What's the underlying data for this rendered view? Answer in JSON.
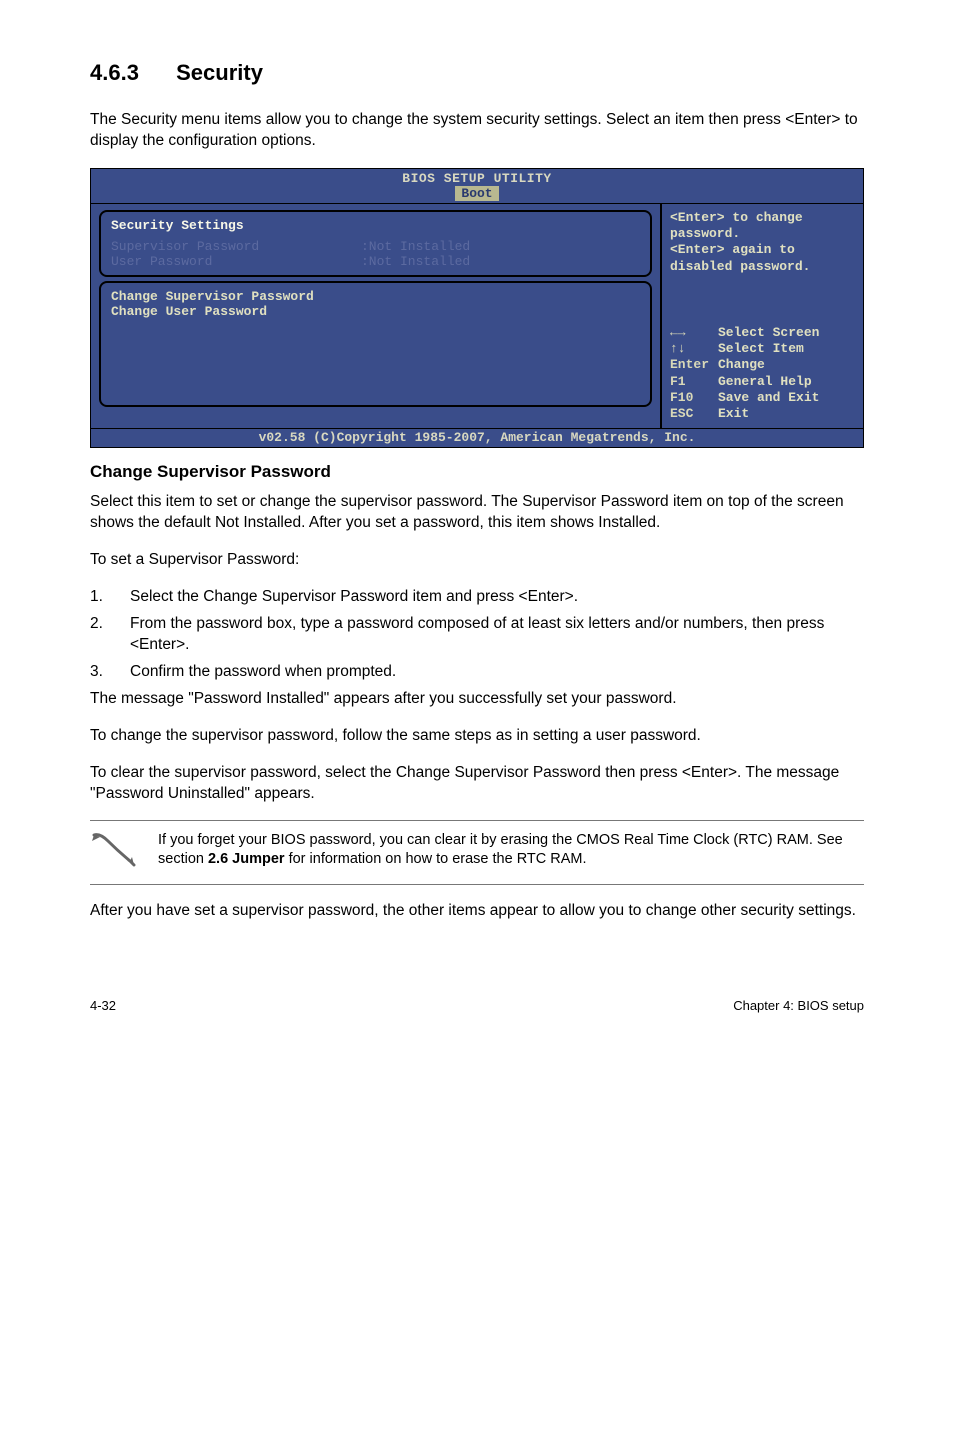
{
  "section": {
    "number": "4.6.3",
    "title": "Security"
  },
  "intro": "The Security menu items allow you to change the system security settings. Select an item then press <Enter> to display the configuration options.",
  "bios": {
    "header_title": "BIOS SETUP UTILITY",
    "tab_active": "Boot",
    "panel1": {
      "title": "Security Settings",
      "rows": [
        {
          "label": "Supervisor Password",
          "value": ":Not Installed"
        },
        {
          "label": "User Password",
          "value": ":Not Installed"
        }
      ]
    },
    "panel2": {
      "lines": [
        "Change Supervisor Password",
        "Change User Password"
      ]
    },
    "help_top": [
      "<Enter> to change",
      "password.",
      "<Enter> again to",
      "disabled password."
    ],
    "help_keys": [
      {
        "k": "",
        "t": "Select Screen"
      },
      {
        "k": "",
        "t": "Select Item"
      },
      {
        "k": "Enter",
        "t": "Change"
      },
      {
        "k": "F1",
        "t": "General Help"
      },
      {
        "k": "F10",
        "t": "Save and Exit"
      },
      {
        "k": "ESC",
        "t": "Exit"
      }
    ],
    "footer": "v02.58 (C)Copyright 1985-2007, American Megatrends, Inc."
  },
  "subhead1": "Change Supervisor Password",
  "para1": "Select this item to set or change the supervisor password. The Supervisor Password item on top of the screen shows the default Not Installed. After you set a password, this item shows Installed.",
  "para2": "To set a Supervisor Password:",
  "steps": [
    "Select the Change Supervisor Password item and press <Enter>.",
    "From the password box, type a password composed of at least six letters and/or numbers, then press <Enter>.",
    "Confirm the password when prompted."
  ],
  "para3": "The message \"Password Installed\" appears after you successfully set your password.",
  "para4": "To change the supervisor password, follow the same steps as in setting a user password.",
  "para5": "To clear the supervisor password, select the Change Supervisor Password then press <Enter>. The message \"Password Uninstalled\" appears.",
  "note": {
    "pre": "If you forget your BIOS password, you can clear it by erasing the CMOS Real Time Clock (RTC) RAM. See section ",
    "bold": "2.6 Jumper",
    "post": " for information on how to erase the RTC RAM."
  },
  "para6": "After you have set a supervisor password, the other items appear to allow you to change other security settings.",
  "footer": {
    "left": "4-32",
    "right": "Chapter 4: BIOS setup"
  },
  "icons": {
    "arrows_lr": "←→",
    "arrows_ud": "↑↓"
  }
}
